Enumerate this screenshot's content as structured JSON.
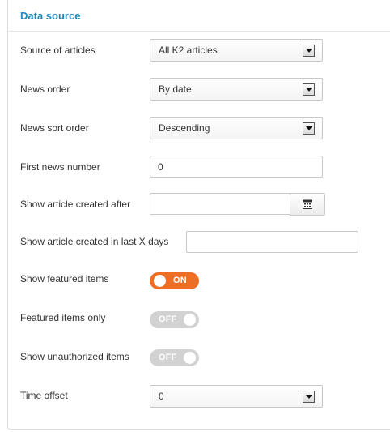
{
  "panel": {
    "title": "Data source"
  },
  "fields": {
    "source_of_articles": {
      "label": "Source of articles",
      "value": "All K2 articles"
    },
    "news_order": {
      "label": "News order",
      "value": "By date"
    },
    "news_sort_order": {
      "label": "News sort order",
      "value": "Descending"
    },
    "first_news_number": {
      "label": "First news number",
      "value": "0"
    },
    "created_after": {
      "label": "Show article created after",
      "value": ""
    },
    "created_last_days": {
      "label": "Show article created in last X days",
      "value": ""
    },
    "show_featured": {
      "label": "Show featured items",
      "state": "ON"
    },
    "featured_only": {
      "label": "Featured items only",
      "state": "OFF"
    },
    "show_unauthorized": {
      "label": "Show unauthorized items",
      "state": "OFF"
    },
    "time_offset": {
      "label": "Time offset",
      "value": "0"
    }
  },
  "icons": {
    "calendar": "calendar-icon",
    "dropdown": "chevron-down-icon"
  },
  "colors": {
    "title": "#1e86c1",
    "toggle_on": "#ee6e23",
    "toggle_off": "#d2d2d2"
  }
}
